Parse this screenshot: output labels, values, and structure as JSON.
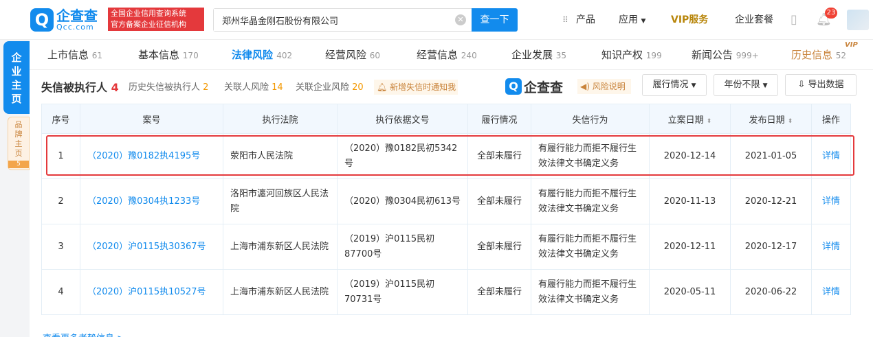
{
  "header": {
    "logo_glyph": "Q",
    "logo_cn": "企查查",
    "logo_en": "Qcc.com",
    "badge_line1": "全国企业信用查询系统",
    "badge_line2": "官方备案企业征信机构",
    "search_value": "郑州华晶金刚石股份有限公司",
    "search_button": "查一下",
    "nav_products": "产品",
    "nav_apps": "应用",
    "nav_vip": "VIP服务",
    "nav_package": "企业套餐",
    "notification_count": "23"
  },
  "side": {
    "main_tab": [
      "企",
      "业",
      "主",
      "页"
    ],
    "brand_tab": [
      "品",
      "牌",
      "主",
      "页"
    ],
    "brand_count": "5"
  },
  "tabs": [
    {
      "label": "上市信息",
      "count": "61"
    },
    {
      "label": "基本信息",
      "count": "170"
    },
    {
      "label": "法律风险",
      "count": "402"
    },
    {
      "label": "经营风险",
      "count": "60"
    },
    {
      "label": "经营信息",
      "count": "240"
    },
    {
      "label": "企业发展",
      "count": "35"
    },
    {
      "label": "知识产权",
      "count": "199"
    },
    {
      "label": "新闻公告",
      "count": "999+"
    },
    {
      "label": "历史信息",
      "count": "52"
    }
  ],
  "vip_tag": "VIP",
  "section": {
    "title": "失信被执行人",
    "title_count": "4",
    "history_label": "历史失信被执行人",
    "history_count": "2",
    "related_person_label": "关联人风险",
    "related_person_count": "14",
    "related_company_label": "关联企业风险",
    "related_company_count": "20",
    "notify_label": "新增失信时通知我",
    "brand_cn": "企查查",
    "risk_label": "风险说明",
    "filter_performance": "履行情况",
    "filter_year": "年份不限",
    "export_label": "导出数据"
  },
  "table": {
    "headers": [
      "序号",
      "案号",
      "执行法院",
      "执行依据文号",
      "履行情况",
      "失信行为",
      "立案日期",
      "发布日期",
      "操作"
    ],
    "rows": [
      {
        "no": "1",
        "case": "（2020）豫0182执4195号",
        "court": "荥阳市人民法院",
        "basis": "（2020）豫0182民初5342号",
        "status": "全部未履行",
        "behavior": "有履行能力而拒不履行生效法律文书确定义务",
        "filed": "2020-12-14",
        "published": "2021-01-05",
        "action": "详情"
      },
      {
        "no": "2",
        "case": "（2020）豫0304执1233号",
        "court": "洛阳市瀍河回族区人民法院",
        "basis": "（2020）豫0304民初613号",
        "status": "全部未履行",
        "behavior": "有履行能力而拒不履行生效法律文书确定义务",
        "filed": "2020-11-13",
        "published": "2020-12-21",
        "action": "详情"
      },
      {
        "no": "3",
        "case": "（2020）沪0115执30367号",
        "court": "上海市浦东新区人民法院",
        "basis": "（2019）沪0115民初87700号",
        "status": "全部未履行",
        "behavior": "有履行能力而拒不履行生效法律文书确定义务",
        "filed": "2020-12-11",
        "published": "2020-12-17",
        "action": "详情"
      },
      {
        "no": "4",
        "case": "（2020）沪0115执10527号",
        "court": "上海市浦东新区人民法院",
        "basis": "（2019）沪0115民初70731号",
        "status": "全部未履行",
        "behavior": "有履行能力而拒不履行生效法律文书确定义务",
        "filed": "2020-05-11",
        "published": "2020-06-22",
        "action": "详情"
      }
    ]
  },
  "more_link": "查看更多老赖信息 >"
}
